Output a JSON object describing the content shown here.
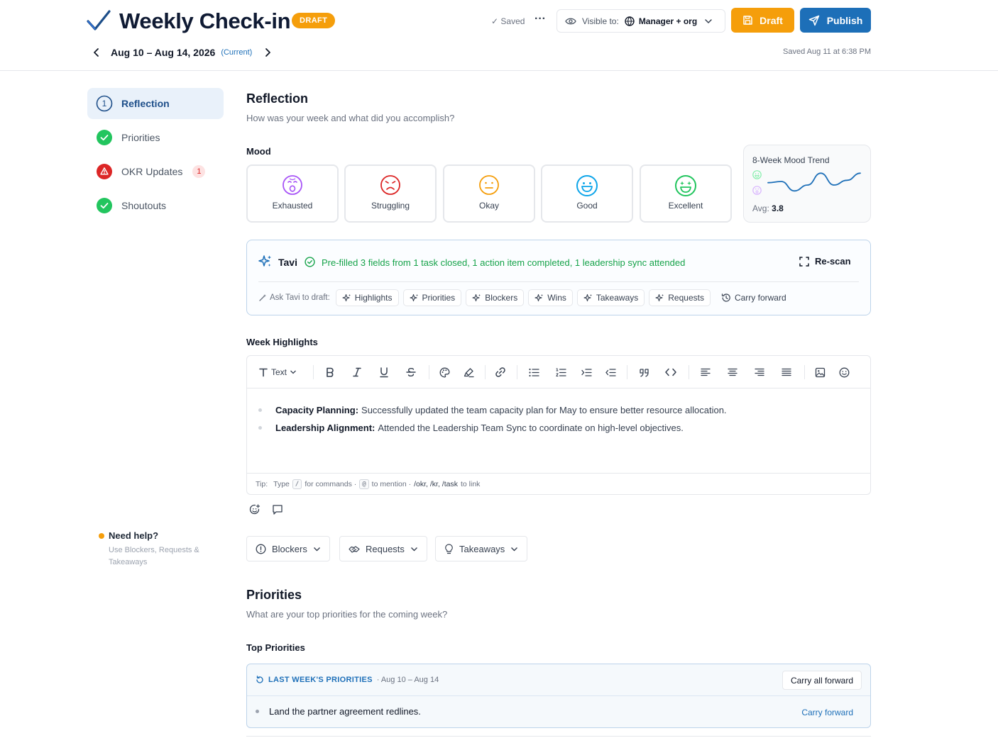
{
  "header": {
    "title": "Weekly Check-in",
    "status_badge": "DRAFT",
    "week_range": "Aug 10 – Aug 14, 2026",
    "week_current": "(Current)",
    "saved_indicator": "✓ Saved",
    "more": "···",
    "visibility_label": "Visible to:",
    "visibility_value": "Manager + org",
    "draft_button": "Draft",
    "publish_button": "Publish",
    "saved_at": "Saved Aug 11 at 6:38 PM"
  },
  "sidebar": {
    "items": [
      {
        "label": "Reflection",
        "state": "current",
        "step": "1"
      },
      {
        "label": "Priorities",
        "state": "complete"
      },
      {
        "label": "OKR Updates",
        "state": "warning",
        "count": "1"
      },
      {
        "label": "Shoutouts",
        "state": "complete"
      }
    ],
    "help_title": "Need help?",
    "help_text": "Use Blockers, Requests & Takeaways"
  },
  "reflection": {
    "title": "Reflection",
    "subtitle": "How was your week and what did you accomplish?",
    "mood_label": "Mood",
    "moods": [
      {
        "label": "Exhausted",
        "color": "#a855f7"
      },
      {
        "label": "Struggling",
        "color": "#dc2626"
      },
      {
        "label": "Okay",
        "color": "#f59e0b"
      },
      {
        "label": "Good",
        "color": "#0ea5e9"
      },
      {
        "label": "Excellent",
        "color": "#22c55e"
      }
    ],
    "trend": {
      "title": "8-Week Mood Trend",
      "avg_label": "Avg:",
      "avg_value": "3.8",
      "values": [
        3.6,
        3.7,
        2.9,
        3.4,
        4.4,
        3.4,
        3.8,
        4.4
      ],
      "color": "#1d6fb8"
    }
  },
  "tavi": {
    "name": "Tavi",
    "message": "Pre-filled 3 fields from 1 task closed, 1 action item completed, 1 leadership sync attended",
    "rescan": "Re-scan",
    "ask_label": "Ask Tavi to draft:",
    "chips": [
      "Highlights",
      "Priorities",
      "Blockers",
      "Wins",
      "Takeaways",
      "Requests"
    ],
    "carry_forward": "Carry forward"
  },
  "highlights": {
    "label": "Week Highlights",
    "toolbar_text": "Text",
    "items": [
      {
        "bold": "Capacity Planning:",
        "text": "Successfully updated the team capacity plan for May to ensure better resource allocation."
      },
      {
        "bold": "Leadership Alignment:",
        "text": "Attended the Leadership Team Sync to coordinate on high-level objectives."
      }
    ],
    "tip": {
      "tip": "Tip:",
      "type": "Type",
      "key1": "/",
      "for_commands": "for commands ·",
      "key2": "@",
      "to_mention": "to mention ·",
      "links": "/okr, /kr, /task",
      "to_link": "to link"
    }
  },
  "accordions": [
    "Blockers",
    "Requests",
    "Takeaways"
  ],
  "priorities": {
    "title": "Priorities",
    "subtitle": "What are your top priorities for the coming week?",
    "top_label": "Top Priorities",
    "last_week_title": "LAST WEEK'S PRIORITIES",
    "last_week_range": "· Aug 10 – Aug 14",
    "carry_all": "Carry all forward",
    "items": [
      "Land the partner agreement redlines."
    ],
    "carry_forward": "Carry forward"
  },
  "colors": {
    "brand": "#1d6fb8",
    "warning": "#f59e0b",
    "success": "#22c55e",
    "danger": "#dc2626"
  }
}
